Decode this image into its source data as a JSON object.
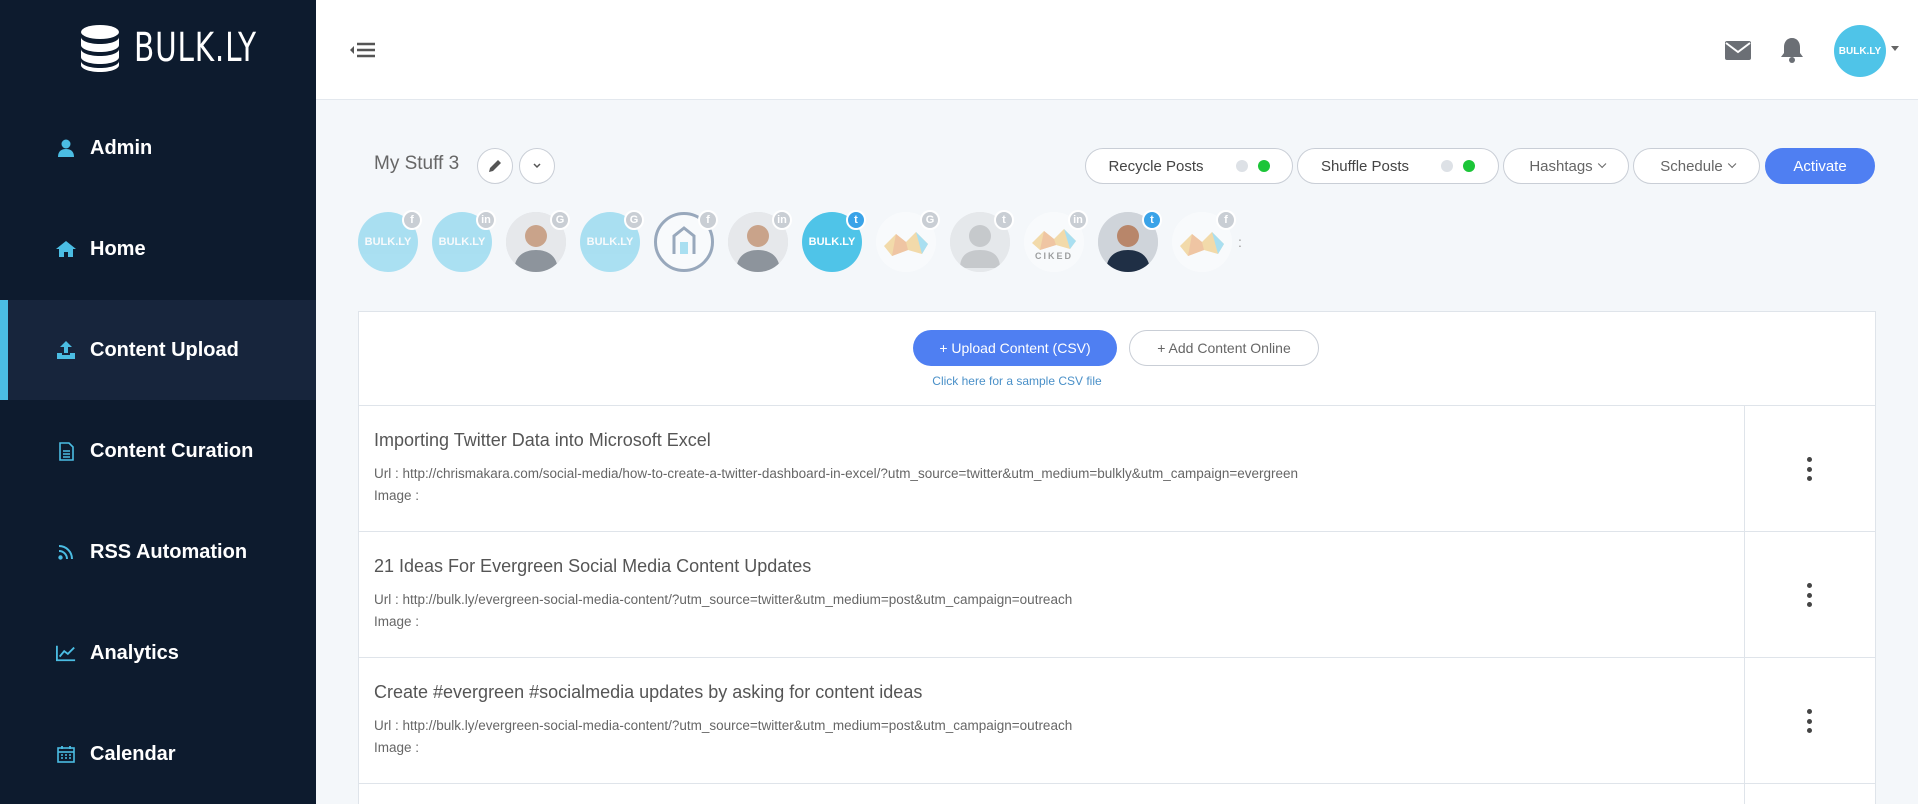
{
  "brand": {
    "name": "BULK.LY"
  },
  "sidebar": {
    "items": [
      {
        "label": "Admin",
        "icon": "user-icon"
      },
      {
        "label": "Home",
        "icon": "home-icon"
      },
      {
        "label": "Content Upload",
        "icon": "upload-icon",
        "active": true
      },
      {
        "label": "Content Curation",
        "icon": "document-icon"
      },
      {
        "label": "RSS Automation",
        "icon": "rss-icon"
      },
      {
        "label": "Analytics",
        "icon": "chart-line-icon"
      },
      {
        "label": "Calendar",
        "icon": "calendar-icon"
      }
    ]
  },
  "topbar": {
    "avatar_label": "BULK.LY"
  },
  "list": {
    "title": "My Stuff 3",
    "recycle_label": "Recycle Posts",
    "shuffle_label": "Shuffle Posts",
    "hashtags_label": "Hashtags",
    "schedule_label": "Schedule",
    "activate_label": "Activate"
  },
  "profiles": [
    {
      "type": "bulkly",
      "network": "f",
      "faded": true
    },
    {
      "type": "bulkly",
      "network": "in",
      "faded": true
    },
    {
      "type": "person",
      "network": "G",
      "faded": false
    },
    {
      "type": "bulkly",
      "network": "G",
      "faded": true
    },
    {
      "type": "logo",
      "network": "f",
      "faded": true
    },
    {
      "type": "person",
      "network": "in",
      "faded": false
    },
    {
      "type": "bulkly",
      "network": "twitter",
      "faded": false
    },
    {
      "type": "ciked",
      "network": "G",
      "faded": true
    },
    {
      "type": "placeholder",
      "network": "twitter",
      "faded": true
    },
    {
      "type": "ciked-text",
      "network": "in",
      "faded": true,
      "label": "CIKED"
    },
    {
      "type": "person",
      "network": "twitter",
      "faded": false
    },
    {
      "type": "ciked",
      "network": "f",
      "faded": true
    }
  ],
  "panel": {
    "upload_label": "+ Upload Content (CSV)",
    "add_label": "+ Add Content Online",
    "sample_link": "Click here for a sample CSV file"
  },
  "posts": [
    {
      "title": "Importing Twitter Data into Microsoft Excel",
      "url": "Url : http://chrismakara.com/social-media/how-to-create-a-twitter-dashboard-in-excel/?utm_source=twitter&utm_medium=bulkly&utm_campaign=evergreen",
      "image": "Image :"
    },
    {
      "title": "21 Ideas For Evergreen Social Media Content Updates",
      "url": "Url : http://bulk.ly/evergreen-social-media-content/?utm_source=twitter&utm_medium=post&utm_campaign=outreach",
      "image": "Image :"
    },
    {
      "title": "Create #evergreen #socialmedia updates by asking for content ideas",
      "url": "Url : http://bulk.ly/evergreen-social-media-content/?utm_source=twitter&utm_medium=post&utm_campaign=outreach",
      "image": "Image :"
    }
  ],
  "colors": {
    "sidebar_bg": "#0d1b2e",
    "sidebar_active_bg": "#17253c",
    "accent": "#4bbde3",
    "primary_button": "#4f7ff2",
    "toggle_on": "#1cc538"
  }
}
